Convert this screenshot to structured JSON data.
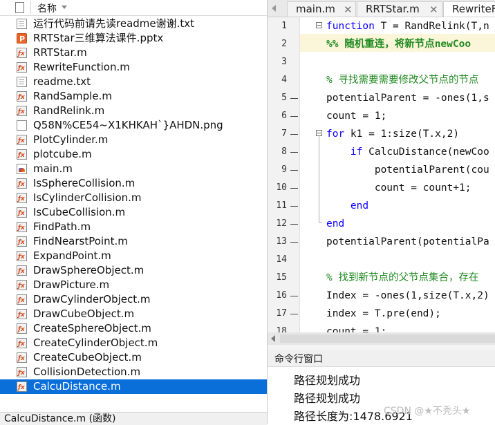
{
  "file_browser": {
    "column_header": "名称",
    "files": [
      {
        "name": "运行代码前请先读readme谢谢.txt",
        "icon": "text-file-icon",
        "type": "txt"
      },
      {
        "name": "RRTStar三维算法课件.pptx",
        "icon": "powerpoint-file-icon",
        "type": "ppt"
      },
      {
        "name": "RRTStar.m",
        "icon": "matlab-function-icon",
        "type": "m"
      },
      {
        "name": "RewriteFunction.m",
        "icon": "matlab-function-icon",
        "type": "m"
      },
      {
        "name": "readme.txt",
        "icon": "text-file-icon",
        "type": "txt"
      },
      {
        "name": "RandSample.m",
        "icon": "matlab-function-icon",
        "type": "m"
      },
      {
        "name": "RandRelink.m",
        "icon": "matlab-function-icon",
        "type": "m"
      },
      {
        "name": "Q58N%CE54~X1KHKAH`}AHDN.png",
        "icon": "image-file-icon",
        "type": "png"
      },
      {
        "name": "PlotCylinder.m",
        "icon": "matlab-function-icon",
        "type": "m"
      },
      {
        "name": "plotcube.m",
        "icon": "matlab-function-icon",
        "type": "m"
      },
      {
        "name": "main.m",
        "icon": "matlab-script-icon",
        "type": "main"
      },
      {
        "name": "IsSphereCollision.m",
        "icon": "matlab-function-icon",
        "type": "m"
      },
      {
        "name": "IsCylinderCollision.m",
        "icon": "matlab-function-icon",
        "type": "m"
      },
      {
        "name": "IsCubeCollision.m",
        "icon": "matlab-function-icon",
        "type": "m"
      },
      {
        "name": "FindPath.m",
        "icon": "matlab-function-icon",
        "type": "m"
      },
      {
        "name": "FindNearstPoint.m",
        "icon": "matlab-function-icon",
        "type": "m"
      },
      {
        "name": "ExpandPoint.m",
        "icon": "matlab-function-icon",
        "type": "m"
      },
      {
        "name": "DrawSphereObject.m",
        "icon": "matlab-function-icon",
        "type": "m"
      },
      {
        "name": "DrawPicture.m",
        "icon": "matlab-function-icon",
        "type": "m"
      },
      {
        "name": "DrawCylinderObject.m",
        "icon": "matlab-function-icon",
        "type": "m"
      },
      {
        "name": "DrawCubeObject.m",
        "icon": "matlab-function-icon",
        "type": "m"
      },
      {
        "name": "CreateSphereObject.m",
        "icon": "matlab-function-icon",
        "type": "m"
      },
      {
        "name": "CreateCylinderObject.m",
        "icon": "matlab-function-icon",
        "type": "m"
      },
      {
        "name": "CreateCubeObject.m",
        "icon": "matlab-function-icon",
        "type": "m"
      },
      {
        "name": "CollisionDetection.m",
        "icon": "matlab-function-icon",
        "type": "m"
      },
      {
        "name": "CalcuDistance.m",
        "icon": "matlab-function-icon",
        "type": "m",
        "selected": true
      }
    ],
    "status": "CalcuDistance.m (函数)"
  },
  "editor": {
    "tabs": [
      {
        "label": "main.m",
        "close": "✕"
      },
      {
        "label": "RRTStar.m",
        "close": "✕"
      },
      {
        "label": "RewriteF",
        "close": ""
      }
    ],
    "lines": [
      {
        "num": "1",
        "html": "<span class=\"kw\">function</span> T = RandRelink(T,n"
      },
      {
        "num": "2",
        "html": "<span class=\"cmb\">%% 随机重连，将新节点newCoo</span>"
      },
      {
        "num": "3",
        "html": ""
      },
      {
        "num": "4",
        "html": "<span class=\"cm\">% 寻找需要需要修改父节点的节点</span>"
      },
      {
        "num": "5",
        "html": "potentialParent = -ones(1,s"
      },
      {
        "num": "6",
        "html": "count = 1;"
      },
      {
        "num": "7",
        "html": "<span class=\"kw\">for</span> k1 = 1:size(T.x,2)"
      },
      {
        "num": "8",
        "html": "    <span class=\"kw\">if</span> CalcuDistance(newCoo"
      },
      {
        "num": "9",
        "html": "        potentialParent(cou"
      },
      {
        "num": "10",
        "html": "        count = count+1;"
      },
      {
        "num": "11",
        "html": "    <span class=\"kw\">end</span>"
      },
      {
        "num": "12",
        "html": "<span class=\"kw\">end</span>"
      },
      {
        "num": "13",
        "html": "potentialParent(potentialPa"
      },
      {
        "num": "14",
        "html": ""
      },
      {
        "num": "15",
        "html": "<span class=\"cm\">% 找到新节点的父节点集合，存在</span>"
      },
      {
        "num": "16",
        "html": "Index = -ones(1,size(T.x,2)"
      },
      {
        "num": "17",
        "html": "index = T.pre(end);"
      },
      {
        "num": "18",
        "html": "count = 1;"
      }
    ],
    "exec_dash_lines": [
      5,
      6,
      7,
      8,
      9,
      10,
      11,
      12,
      13,
      16,
      17
    ]
  },
  "command_window": {
    "title": "命令行窗口",
    "output": [
      "路径规划成功",
      "路径规划成功",
      "路径长度为:1478.6921"
    ]
  },
  "watermark": "CSDN @★不秃头★",
  "colors": {
    "selection": "#0a6fd9",
    "keyword": "#0e00ff",
    "comment": "#228b22",
    "cell_highlight": "#fbf6d9"
  }
}
